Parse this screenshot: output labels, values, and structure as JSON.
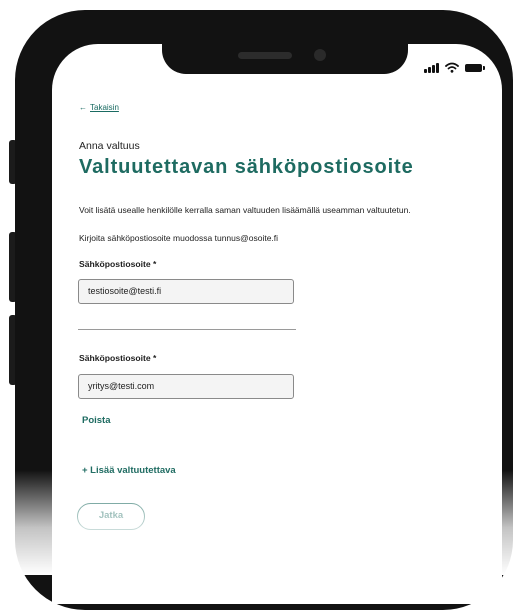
{
  "status_bar": {
    "signal_icon": "signal-bars-icon",
    "wifi_icon": "wifi-icon",
    "battery_icon": "battery-icon"
  },
  "nav": {
    "back_arrow": "←",
    "back_label": "Takaisin"
  },
  "page": {
    "eyebrow": "Anna valtuus",
    "title": "Valtuutettavan sähköpostiosoite",
    "description": "Voit lisätä usealle henkilölle kerralla saman valtuuden lisäämällä useamman valtuutetun.",
    "format_hint": "Kirjoita sähköpostiosoite muodossa tunnus@osoite.fi"
  },
  "emails": [
    {
      "label": "Sähköpostiosoite *",
      "value": "testiosoite@testi.fi"
    },
    {
      "label": "Sähköpostiosoite *",
      "value": "yritys@testi.com",
      "remove_label": "Poista"
    }
  ],
  "actions": {
    "add_label": "+ Lisää valtuutettava",
    "continue_label": "Jatka"
  },
  "colors": {
    "accent": "#1e6b61",
    "phone_frame": "#121212",
    "input_bg": "#f4f4f4"
  }
}
